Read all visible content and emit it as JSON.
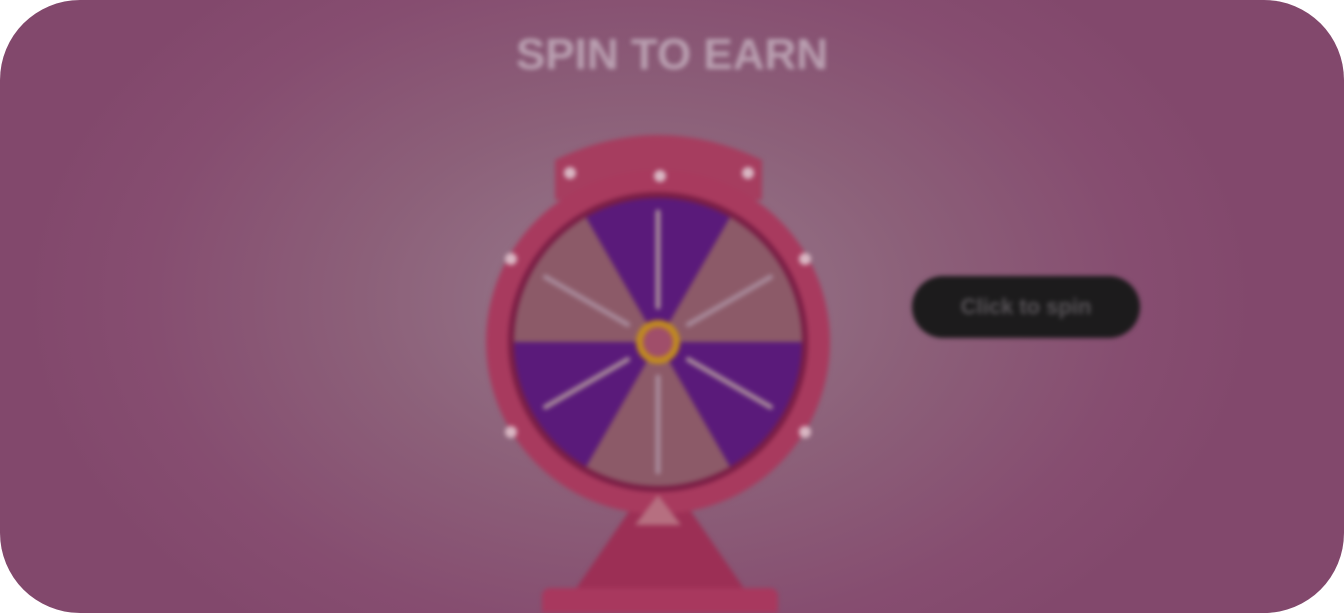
{
  "title": "SPIN TO EARN",
  "spin_button": "Click to spin",
  "colors": {
    "segment_purple": "#5a1a7a",
    "segment_pink": "#8a5a6a",
    "rim": "#a83a5e",
    "hub": "#c08a20",
    "button_bg": "#1c1b1c"
  }
}
